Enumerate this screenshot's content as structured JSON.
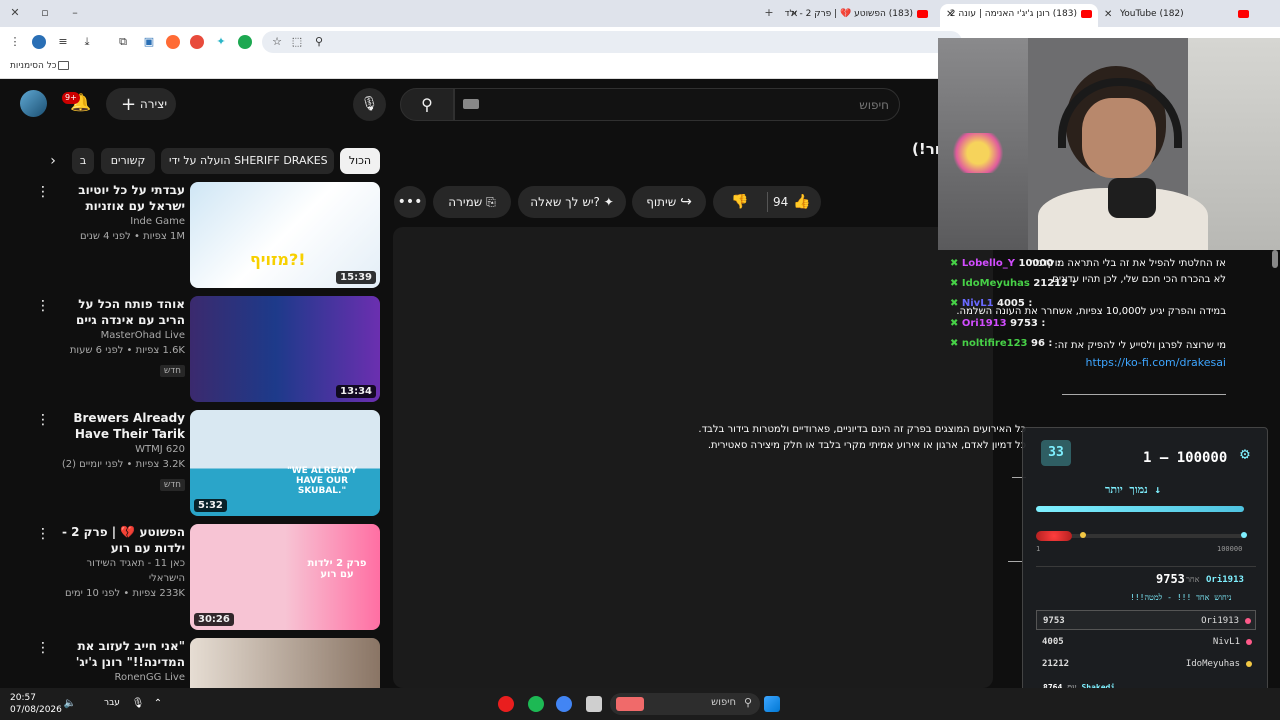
{
  "browser": {
    "tabs": [
      {
        "label": "YouTube (182)",
        "active": false
      },
      {
        "label": "(183) רונן ג'יג'י האנימה | עונה 2",
        "active": true
      },
      {
        "label": "(183) הפשוטע 💔 | פרק 2 - ילד",
        "active": false
      }
    ],
    "bookmarks_label": "כל הסימניות"
  },
  "youtube": {
    "notification_count": "9+",
    "create_label": "יצירה",
    "search_placeholder": "חיפוש",
    "video_title_fragment": "(!ור",
    "chips": [
      "הכול",
      "הועלה על ידי SHERIFF DRAKES",
      "קשורים",
      "ב"
    ],
    "actions": {
      "likes": "94",
      "share": "שיתוף",
      "ask": "יש לך שאלה?",
      "save": "שמירה"
    },
    "related": [
      {
        "title": "עבדתי על כל יוטיוב ישראל עם אוזניות מזויפות ?! ...",
        "channel": "Inde Game",
        "stats": "1M צפיות • לפני 4 שנים",
        "duration": "15:39",
        "new": "",
        "thumb_caption": "מזויף?!"
      },
      {
        "title": "אוהד פותח הכל על הריב עם אינדה גיים",
        "channel": "MasterOhad Live",
        "stats": "1.6K צפיות • לפני 6 שעות",
        "duration": "13:34",
        "new": "חדש",
        "thumb_caption": ""
      },
      {
        "title": "Brewers Already Have Their Tarik Skubal Jeff ...",
        "channel": "620 WTMJ",
        "stats": "3.2K צפיות • לפני יומיים (2)",
        "duration": "5:32",
        "new": "חדש",
        "thumb_caption": "\"WE ALREADY HAVE OUR SKUBAL.\""
      },
      {
        "title": "הפשוטע 💔 | פרק 2 - ילדות עם רוע",
        "channel": "כאן 11 - תאגיד השידור הישראלי",
        "stats": "233K צפיות • לפני 10 ימים",
        "duration": "30:26",
        "new": "",
        "thumb_caption": "פרק 2 ילדות עם רוע"
      },
      {
        "title": "\"אני חייב לעזוב את המדינה!!\" רונן ג'יג' מגיב ...",
        "channel": "RonenGG Live",
        "stats": "",
        "duration": "",
        "new": "",
        "thumb_caption": ""
      }
    ],
    "description": {
      "line1": "אז החלטתי להפיל את זה בלי התראה מוקדמת",
      "line2": "לא בהכרח הכי חכם שלי, לכן תהיו עדינים",
      "line3": "במידה והפרק יגיע ל10,000 צפיות, אשחרר את העונה השלמה.",
      "line4": "מי שרוצה לפרגן ולסייע לי להפיק את זה:",
      "link": "https://ko-fi.com/drakesai",
      "line5": "כל האירועים המוצגים בפרק זה הינם בדיוניים, פארודיים ולמטרות בידור בלבד.",
      "line6": "כל דמיון לאדם, ארגון או אירוע אמיתי מקרי בלבד או חלק מיצירה סאטירית."
    }
  },
  "stream_overlay": {
    "chat": [
      {
        "user": "Lobello_Y",
        "text": "10000 :",
        "color": "#d24dff"
      },
      {
        "user": "IdoMeyuhas",
        "text": "21212 :",
        "color": "#47d147"
      },
      {
        "user": "NivL1",
        "text": "4005 :",
        "color": "#6a6aff"
      },
      {
        "user": "Ori1913",
        "text": "9753 :",
        "color": "#d24dff"
      },
      {
        "user": "noltifire123",
        "text": "96 :",
        "color": "#47d147"
      }
    ],
    "leaderboard": {
      "badge": "33",
      "range": "1 — 100000",
      "hint": "נמוך יותר",
      "scale_min": "1",
      "scale_max": "100000",
      "top_value": "9753",
      "top_user": "Ori1913",
      "top_label": "אחר",
      "top_sub": "ניחוש אחד !!! - למטה!!!",
      "rows": [
        {
          "user": "Ori1913",
          "value": "9753"
        },
        {
          "user": "NivL1",
          "value": "4005"
        },
        {
          "user": "IdoMeyuhas",
          "value": "21212"
        }
      ],
      "footer_value": "8764",
      "footer_user": "Shakedi",
      "footer_label": "עם"
    }
  },
  "taskbar": {
    "time": "20:57",
    "date": "07/08/2026",
    "lang": "עבר",
    "search_placeholder": "חיפוש"
  }
}
